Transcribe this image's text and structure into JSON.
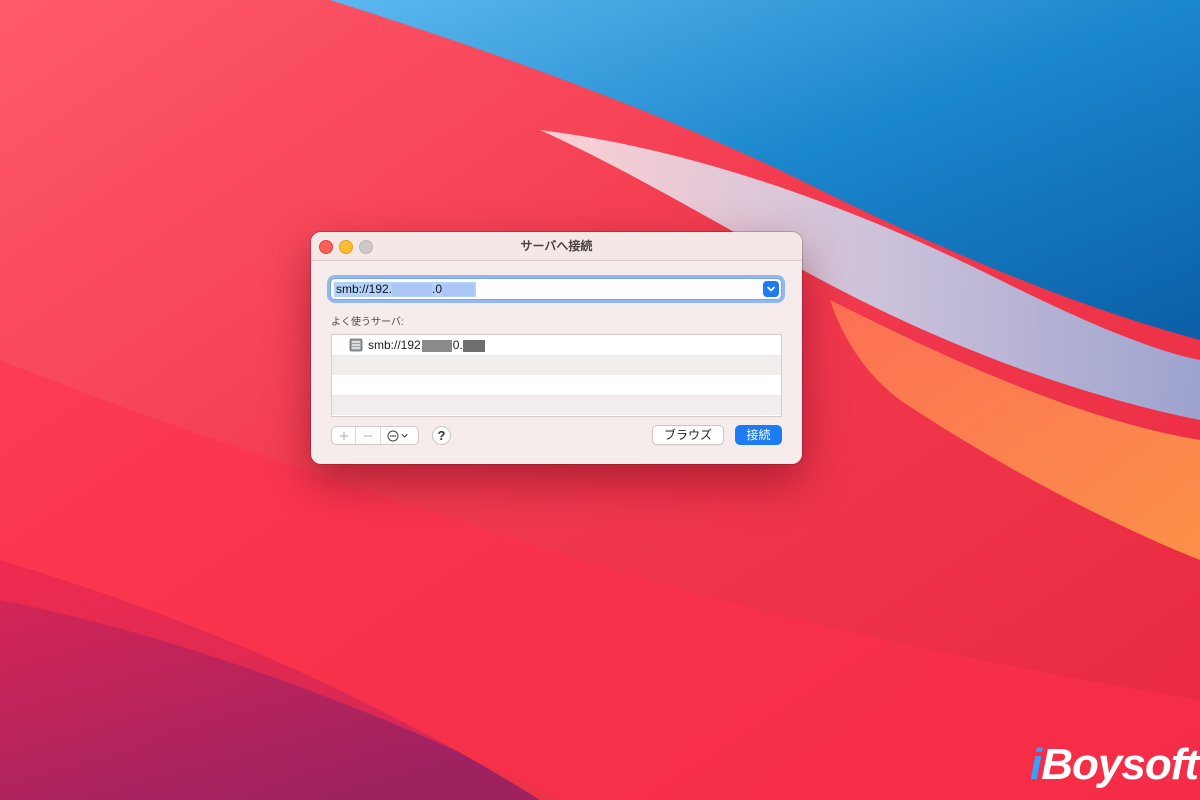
{
  "window": {
    "title": "サーバへ接続"
  },
  "address": {
    "prefix": "smb://192.",
    "middle": ".0"
  },
  "favorites": {
    "label": "よく使うサーバ:",
    "items": [
      {
        "prefix": "smb://192",
        "middle": "0."
      }
    ]
  },
  "buttons": {
    "browse": "ブラウズ",
    "connect": "接続",
    "help": "?"
  },
  "brand": {
    "logo_prefix": "i",
    "logo_rest": "Boysoft"
  },
  "colors": {
    "accent": "#1d7bf3",
    "close": "#fe5f57",
    "minimize": "#febc2e",
    "zoom_inactive": "#cfc8c8"
  },
  "icons": {
    "close": "close-icon",
    "minimize": "minimize-icon",
    "zoom": "zoom-icon",
    "dropdown": "chevron-down-icon",
    "server": "server-icon",
    "add": "plus-icon",
    "remove": "minus-icon",
    "more": "ellipsis-circle-icon"
  }
}
